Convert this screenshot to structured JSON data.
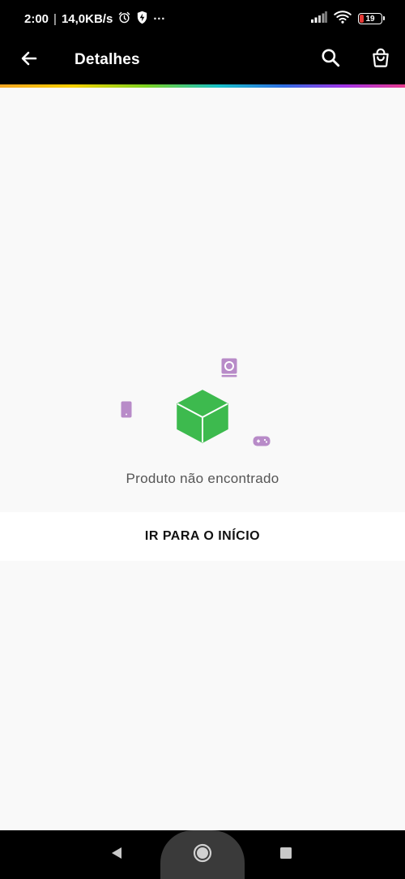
{
  "status_bar": {
    "time": "2:00",
    "separator": "|",
    "network_speed": "14,0KB/s",
    "more": "···",
    "battery_level": "19",
    "icons": [
      "alarm-icon",
      "shield-bolt-icon",
      "signal-icon",
      "wifi-icon",
      "battery-icon"
    ],
    "battery_color": "#e53935"
  },
  "app_bar": {
    "title": "Detalhes",
    "back_icon": "arrow-left-icon",
    "search_icon": "search-icon",
    "cart_icon": "shopping-bag-icon",
    "accent_gradient": [
      "#f5a623",
      "#f8d000",
      "#7ed321",
      "#18c1c9",
      "#2f6fe4",
      "#a334e8",
      "#e83b8d"
    ]
  },
  "empty_state": {
    "message": "Produto não encontrado",
    "button_label": "IR PARA O INÍCIO",
    "illustration_icons": [
      "book-icon",
      "phone-icon",
      "box-icon",
      "gamepad-icon"
    ],
    "box_color": "#3dba4e",
    "icon_color": "#b88bc8"
  },
  "nav_bar": {
    "icons": [
      "back-triangle-icon",
      "home-circle-icon",
      "recents-square-icon"
    ]
  }
}
